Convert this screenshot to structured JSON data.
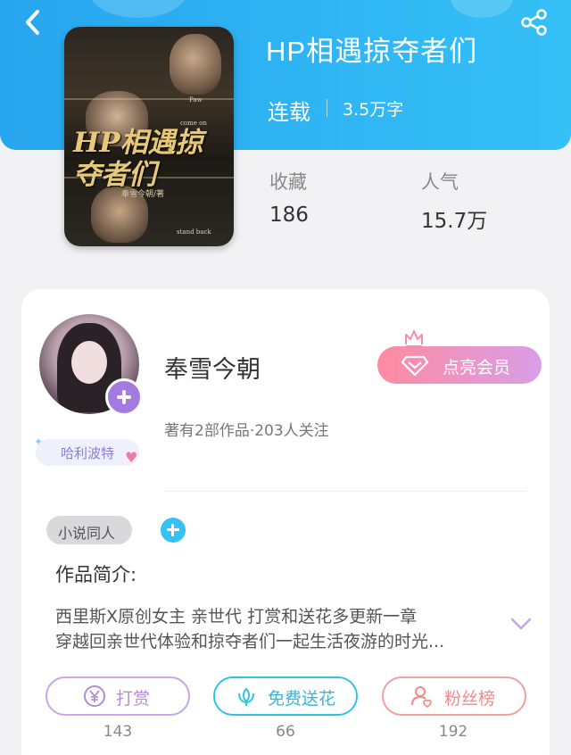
{
  "header": {
    "back_icon": "back-chevron-icon",
    "share_icon": "share-icon",
    "accent": "#2ea9f0"
  },
  "book": {
    "title": "HP相遇掠夺者们",
    "status": "连载",
    "word_count": "3.5万字",
    "cover": {
      "title": "HP相遇掠夺者们",
      "author": "奉雪今朝/著",
      "tags": [
        "Paw",
        "come on",
        "stand back"
      ]
    },
    "stats": [
      {
        "label": "收藏",
        "value": "186"
      },
      {
        "label": "人气",
        "value": "15.7万"
      }
    ]
  },
  "author": {
    "name": "奉雪今朝",
    "meta": "著有2部作品·203人关注",
    "fan_badge": "哈利波特",
    "follow_icon": "plus-icon",
    "vip_button": "点亮会员",
    "vip_colors": [
      "#ff8aa0",
      "#d99ee8"
    ]
  },
  "tags": {
    "category": "小说同人",
    "add_icon": "plus-icon"
  },
  "intro": {
    "heading": "作品简介:",
    "lines": [
      "西里斯X原创女主 亲世代   打赏和送花多更新一章",
      "穿越回亲世代体验和掠夺者们一起生活夜游的时光..."
    ],
    "expand_icon": "chevron-down-icon"
  },
  "actions": [
    {
      "label": "打赏",
      "count": "143",
      "icon": "yen-coin-icon",
      "color": "#b48bd8"
    },
    {
      "label": "免费送花",
      "count": "66",
      "icon": "flower-icon",
      "color": "#31c3e6"
    },
    {
      "label": "粉丝榜",
      "count": "192",
      "icon": "fans-ranking-icon",
      "color": "#f08a8a"
    }
  ]
}
